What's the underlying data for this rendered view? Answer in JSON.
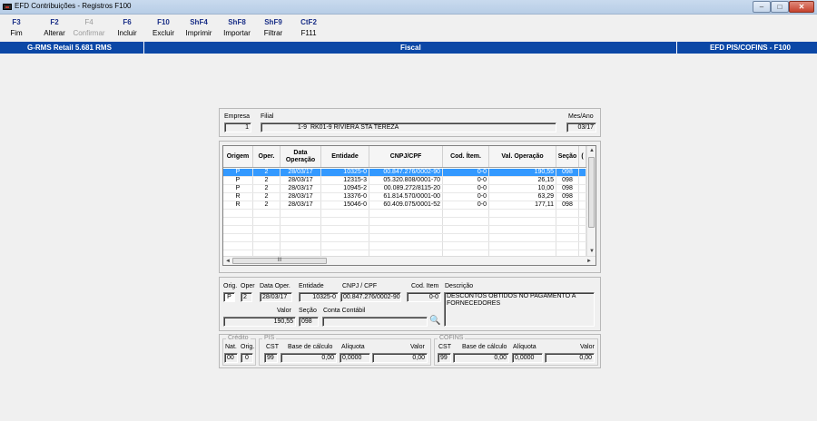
{
  "window": {
    "title": "EFD Contribuições - Registros F100",
    "min_label": "‒",
    "max_label": "□",
    "close_label": "✕"
  },
  "toolbar": [
    {
      "key": "F3",
      "label": "Fim",
      "enabled": true
    },
    {
      "key": "F2",
      "label": "Alterar",
      "enabled": true
    },
    {
      "key": "F4",
      "label": "Confirmar",
      "enabled": false
    },
    {
      "key": "F6",
      "label": "Incluir",
      "enabled": true
    },
    {
      "key": "F10",
      "label": "Excluir",
      "enabled": true
    },
    {
      "key": "ShF4",
      "label": "Imprimir",
      "enabled": true
    },
    {
      "key": "ShF8",
      "label": "Importar",
      "enabled": true
    },
    {
      "key": "ShF9",
      "label": "Filtrar",
      "enabled": true
    },
    {
      "key": "CtF2",
      "label": "F111",
      "enabled": true
    }
  ],
  "statusbar": {
    "left": "G-RMS Retail 5.681 RMS",
    "center": "Fiscal",
    "right": "EFD PIS/COFINS - F100"
  },
  "header": {
    "empresa_label": "Empresa",
    "empresa_value": "1",
    "filial_label": "Filial",
    "filial_code": "1-9",
    "filial_name": "RK01-9 RIVIERA STA TEREZA",
    "mesano_label": "Mes/Ano",
    "mesano_value": "03/17"
  },
  "grid": {
    "columns": [
      "Origem",
      "Oper.",
      "Data Operação",
      "Entidade",
      "CNPJ/CPF",
      "Cod. Ítem.",
      "Val. Operação",
      "Seção",
      "("
    ],
    "rows": [
      [
        "P",
        "2",
        "28/03/17",
        "10325-0",
        "00.847.276/0002-90",
        "0-0",
        "190,55",
        "098"
      ],
      [
        "P",
        "2",
        "28/03/17",
        "12315-3",
        "05.320.808/0001-70",
        "0-0",
        "26,15",
        "098"
      ],
      [
        "P",
        "2",
        "28/03/17",
        "10945-2",
        "00.089.272/8115-20",
        "0-0",
        "10,00",
        "098"
      ],
      [
        "R",
        "2",
        "28/03/17",
        "13376-0",
        "61.814.570/0001-00",
        "0-0",
        "63,29",
        "098"
      ],
      [
        "R",
        "2",
        "28/03/17",
        "15046-0",
        "60.409.075/0001-52",
        "0-0",
        "177,11",
        "098"
      ]
    ],
    "selected_row": 0,
    "hscroll_grip": "III"
  },
  "detail": {
    "orig_label": "Orig.",
    "orig_value": "P",
    "oper_label": "Oper",
    "oper_value": "2",
    "data_label": "Data Oper.",
    "data_value": "28/03/17",
    "entidade_label": "Entidade",
    "entidade_value": "10325-0",
    "cnpj_label": "CNPJ / CPF",
    "cnpj_value": "00.847.276/0002-90",
    "coditem_label": "Cod. Item",
    "coditem_value": "0-0",
    "descricao_label": "Descrição",
    "descricao_value": "DESCONTOS OBTIDOS NO PAGAMENTO A FORNECEDORES",
    "valor_label": "Valor",
    "valor_value": "190,55",
    "secao_label": "Seção",
    "secao_value": "098",
    "conta_label": "Conta Contábil",
    "conta_value": ""
  },
  "credito": {
    "title": "Crédito",
    "nat_label": "Nat.",
    "nat_value": "00",
    "orig_label": "Orig.",
    "orig_value": "0"
  },
  "pis": {
    "title": "PIS",
    "cst_label": "CST",
    "cst_value": "99",
    "base_label": "Base de cálculo",
    "base_value": "0,00",
    "aliq_label": "Alíquota",
    "aliq_value": "0,0000",
    "valor_label": "Valor",
    "valor_value": "0,00"
  },
  "cofins": {
    "title": "COFINS",
    "cst_label": "CST",
    "cst_value": "99",
    "base_label": "Base de cálculo",
    "base_value": "0,00",
    "aliq_label": "Alíquota",
    "aliq_value": "0,0000",
    "valor_label": "Valor",
    "valor_value": "0,00"
  }
}
